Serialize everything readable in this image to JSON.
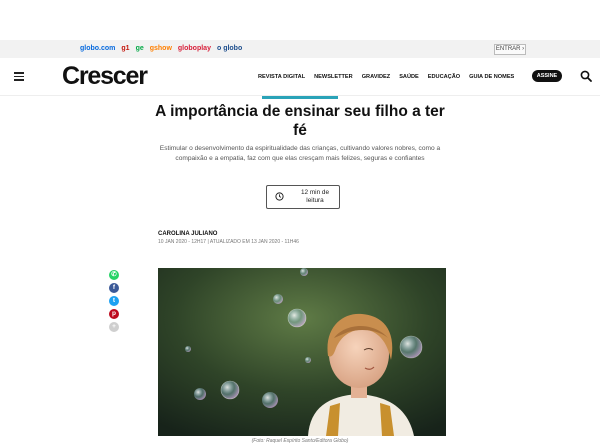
{
  "globo_bar": {
    "links": [
      {
        "label": "globo.com",
        "color": "#0669de"
      },
      {
        "label": "g1",
        "color": "#c4170c"
      },
      {
        "label": "ge",
        "color": "#06aa48"
      },
      {
        "label": "gshow",
        "color": "#ff7f00"
      },
      {
        "label": "globoplay",
        "color": "#d8213b"
      },
      {
        "label": "o globo",
        "color": "#1c4d8c"
      }
    ],
    "login_label": "ENTRAR ›"
  },
  "header": {
    "brand": "Crescer",
    "nav": [
      "REVISTA DIGITAL",
      "NEWSLETTER",
      "GRAVIDEZ",
      "SAÚDE",
      "EDUCAÇÃO",
      "GUIA DE NOMES"
    ],
    "subscribe_label": "ASSINE",
    "accent_color": "#2aa3b8"
  },
  "article": {
    "title": "A importância de ensinar seu filho a ter fé",
    "subtitle": "Estimular o desenvolvimento da espiritualidade das crianças, cultivando valores nobres, como a compaixão e a empatia, faz com que elas cresçam mais felizes, seguras e confiantes",
    "reading_time": "12 min de leitura",
    "author": "CAROLINA JULIANO",
    "dates": "10 JAN 2020 - 12H17 | ATUALIZADO EM 13 JAN 2020 - 11H46",
    "photo_caption": "(Foto: Raquel Espírito Santo/Editora Globo)"
  },
  "share": [
    {
      "icon": "whatsapp-icon",
      "glyph": "✆",
      "color": "#25d366"
    },
    {
      "icon": "facebook-icon",
      "glyph": "f",
      "color": "#3b5998"
    },
    {
      "icon": "twitter-icon",
      "glyph": "t",
      "color": "#1da1f2"
    },
    {
      "icon": "pinterest-icon",
      "glyph": "p",
      "color": "#bd081c"
    },
    {
      "icon": "more-icon",
      "glyph": "+",
      "color": "#cfcfcf"
    }
  ]
}
